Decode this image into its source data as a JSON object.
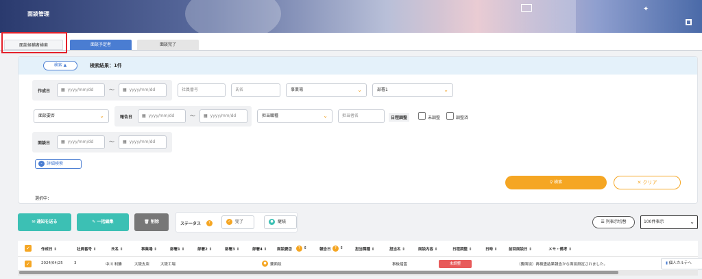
{
  "header": {
    "title": "面談管理"
  },
  "tabs": [
    {
      "label": "面談候補者検索"
    },
    {
      "label": "面談予定者"
    },
    {
      "label": "面談完了"
    }
  ],
  "search": {
    "toggle_label": "検索",
    "results_label": "検索結果：1件",
    "created_date_label": "作成日",
    "date_placeholder": "yyyy/mm/dd",
    "tilde": "〜",
    "employee_no_placeholder": "社員番号",
    "name_placeholder": "氏名",
    "office_select": "事業場",
    "dept1_select": "部署1",
    "need_select": "面談要否",
    "report_date_label": "報告日",
    "job_select": "担当職種",
    "staff_placeholder": "担当者名",
    "schedule_label": "日程調整",
    "unadjusted_label": "未調整",
    "adjusted_label": "調整済",
    "interview_date_label": "面談日",
    "detail_label": "詳細検索",
    "search_button": "検索",
    "clear_button": "クリア",
    "selecting_label": "選択中："
  },
  "actions": {
    "notify": "通知を送る",
    "bulk_edit": "一括編集",
    "delete": "削除",
    "status_label": "ステータス",
    "complete": "完了",
    "continue": "継続",
    "column_toggle": "列表示切替",
    "page_size": "100件表示"
  },
  "table": {
    "headers": [
      "作成日 ⇕",
      "社員番号 ⇕",
      "氏名 ⇕",
      "事業場 ⇕",
      "部署1 ⇕",
      "部署2 ⇕",
      "部署3 ⇕",
      "部署4 ⇕",
      "面談要否",
      "⇕",
      "報告日",
      "⇕",
      "担当職種 ⇕",
      "担当名 ⇕",
      "面談内容 ⇕",
      "日程調整 ⇕",
      "日時 ⇕",
      "前回面談日 ⇕",
      "メモ・備考 ⇕"
    ],
    "rows": [
      {
        "created": "2024/04/25",
        "employee_no": "3",
        "name": "中川 利勝",
        "office": "大阪支店",
        "dept1": "大阪工場",
        "need": "要面談",
        "staff": "事後措置",
        "status": "未調整",
        "memo": "（要面談）再検査結果報告から面談設定されました。",
        "karte": "個人カルテへ"
      }
    ]
  },
  "colors": {
    "accent_orange": "#f5a623",
    "tab_blue": "#4a7dd2",
    "notify_teal": "#3cc0b4",
    "delete_gray": "#777777",
    "badge_red": "#e85a5a"
  }
}
